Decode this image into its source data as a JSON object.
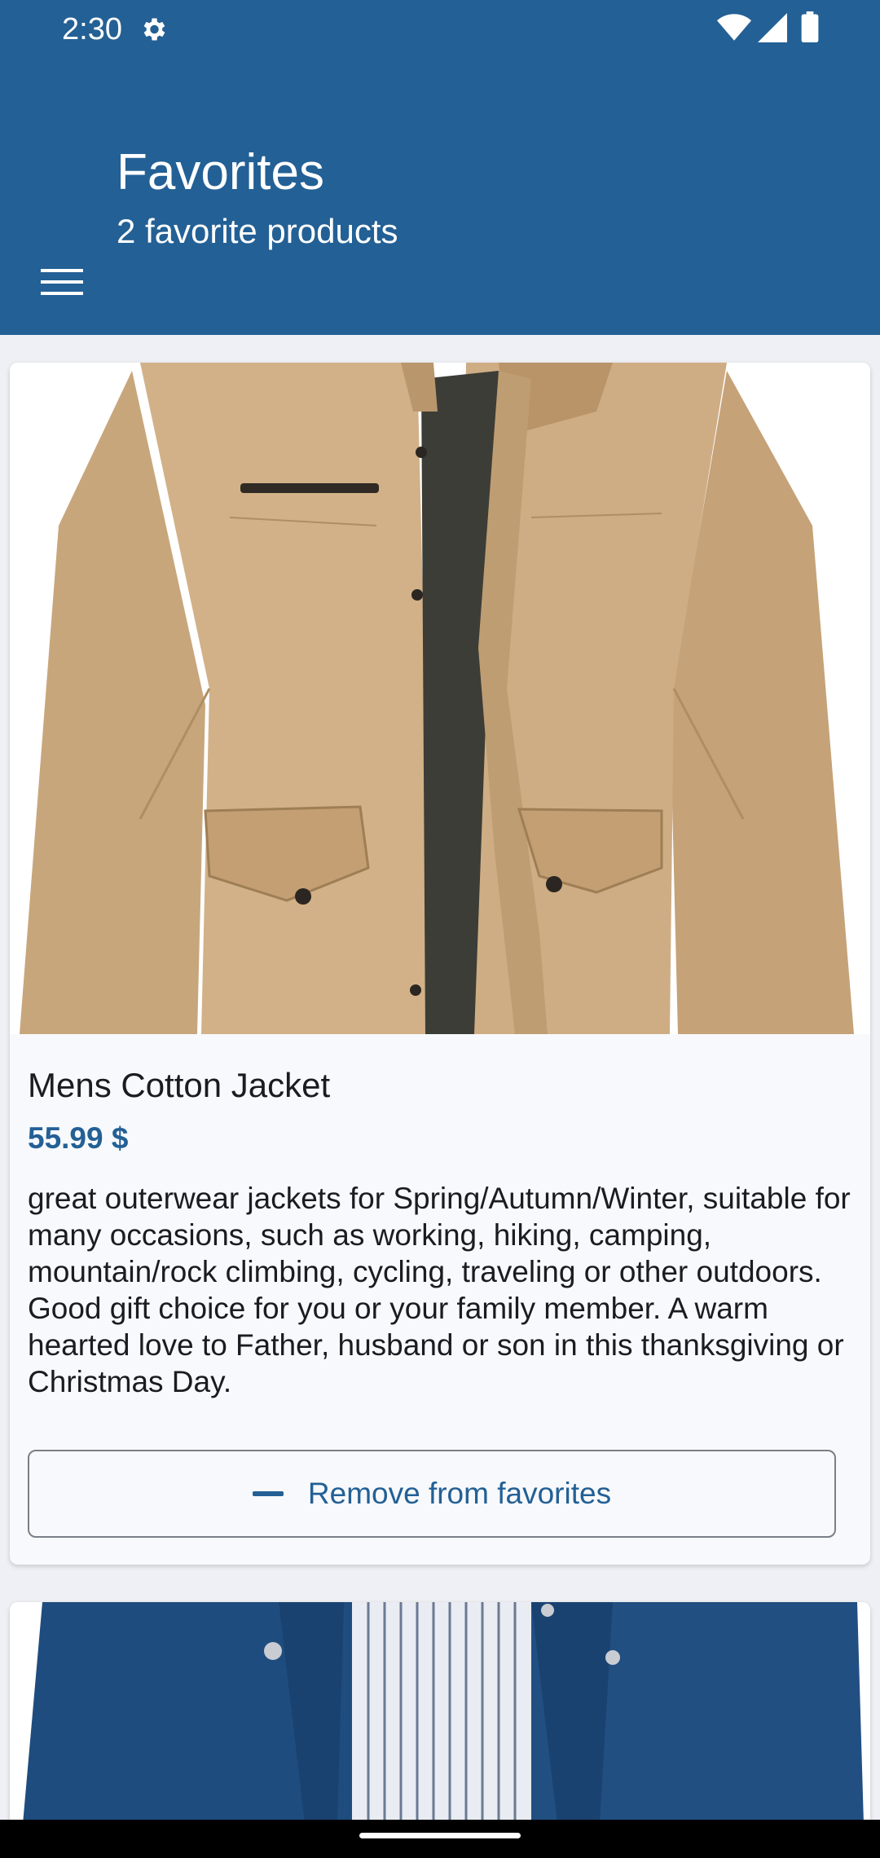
{
  "status_bar": {
    "time": "2:30",
    "icons": [
      "gear-icon",
      "wifi-icon",
      "signal-icon",
      "battery-icon"
    ]
  },
  "app_bar": {
    "title": "Favorites",
    "subtitle": "2 favorite products",
    "menu_icon": "hamburger-menu-icon",
    "background": "#236095"
  },
  "products": [
    {
      "image_icon": "khaki-jacket-image",
      "name": "Mens Cotton Jacket",
      "price": "55.99 $",
      "description": "great outerwear jackets for Spring/Autumn/Winter, suitable for many occasions, such as working, hiking, camping, mountain/rock climbing, cycling, traveling or other outdoors. Good gift choice for you or your family member. A warm hearted love to Father, husband or son in this thanksgiving or Christmas Day.",
      "remove_label": "Remove from favorites"
    },
    {
      "image_icon": "navy-jacket-image"
    }
  ],
  "colors": {
    "accent": "#236095",
    "card_bg": "#f8f9fc",
    "page_bg": "#eef0f5"
  }
}
